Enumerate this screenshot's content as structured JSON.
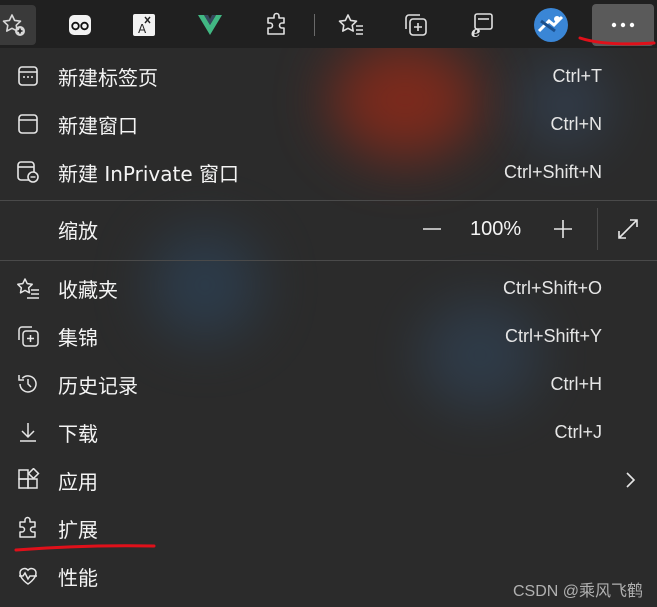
{
  "toolbar": {
    "buttons": [
      {
        "name": "favorites-add-icon"
      },
      {
        "name": "extension-app-icon"
      },
      {
        "name": "translate-icon"
      },
      {
        "name": "vue-devtools-icon"
      },
      {
        "name": "extensions-icon"
      },
      {
        "name": "favorites-icon"
      },
      {
        "name": "collections-icon"
      },
      {
        "name": "ie-mode-icon"
      },
      {
        "name": "profile-avatar"
      },
      {
        "name": "more-menu-icon"
      }
    ],
    "translate_glyph": "A",
    "accent_annotation_color": "#e0101a"
  },
  "menu": {
    "new_tab": {
      "label": "新建标签页",
      "shortcut": "Ctrl+T"
    },
    "new_window": {
      "label": "新建窗口",
      "shortcut": "Ctrl+N"
    },
    "new_inprivate": {
      "label": "新建 InPrivate 窗口",
      "shortcut": "Ctrl+Shift+N"
    },
    "zoom": {
      "label": "缩放",
      "value": "100%",
      "minus": "—",
      "plus": "+"
    },
    "favorites": {
      "label": "收藏夹",
      "shortcut": "Ctrl+Shift+O"
    },
    "collections": {
      "label": "集锦",
      "shortcut": "Ctrl+Shift+Y"
    },
    "history": {
      "label": "历史记录",
      "shortcut": "Ctrl+H"
    },
    "downloads": {
      "label": "下载",
      "shortcut": "Ctrl+J"
    },
    "apps": {
      "label": "应用"
    },
    "extensions": {
      "label": "扩展"
    },
    "performance": {
      "label": "性能"
    }
  },
  "watermark": "CSDN @乘风飞鹤"
}
